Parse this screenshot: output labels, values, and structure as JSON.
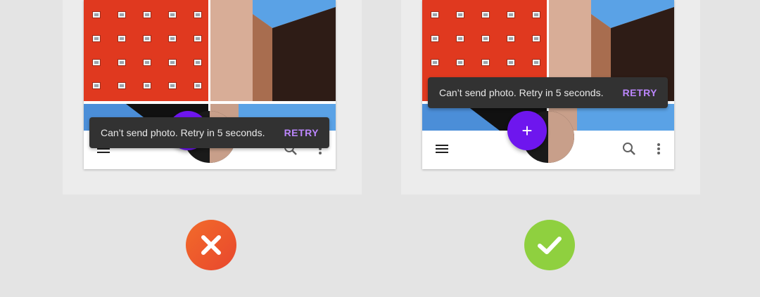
{
  "examples": [
    {
      "id": "incorrect",
      "snackbar": {
        "message": "Can’t send photo. Retry in 5 seconds.",
        "action": "RETRY"
      },
      "fab_label": "+",
      "verdict_icon": "x-icon",
      "verdict_color": "#ec5a2c"
    },
    {
      "id": "correct",
      "snackbar": {
        "message": "Can’t send photo. Retry in 5 seconds.",
        "action": "RETRY"
      },
      "fab_label": "+",
      "verdict_icon": "check-icon",
      "verdict_color": "#8fd03f"
    }
  ],
  "colors": {
    "fab": "#6e16ee",
    "snackbar_bg": "#323232",
    "snackbar_action": "#bb86fc",
    "building_red": "#e0391f",
    "sky_blue": "#4b8ed8"
  },
  "icons": {
    "nav": "menu-icon",
    "search": "search-icon",
    "overflow": "more-vert-icon"
  }
}
